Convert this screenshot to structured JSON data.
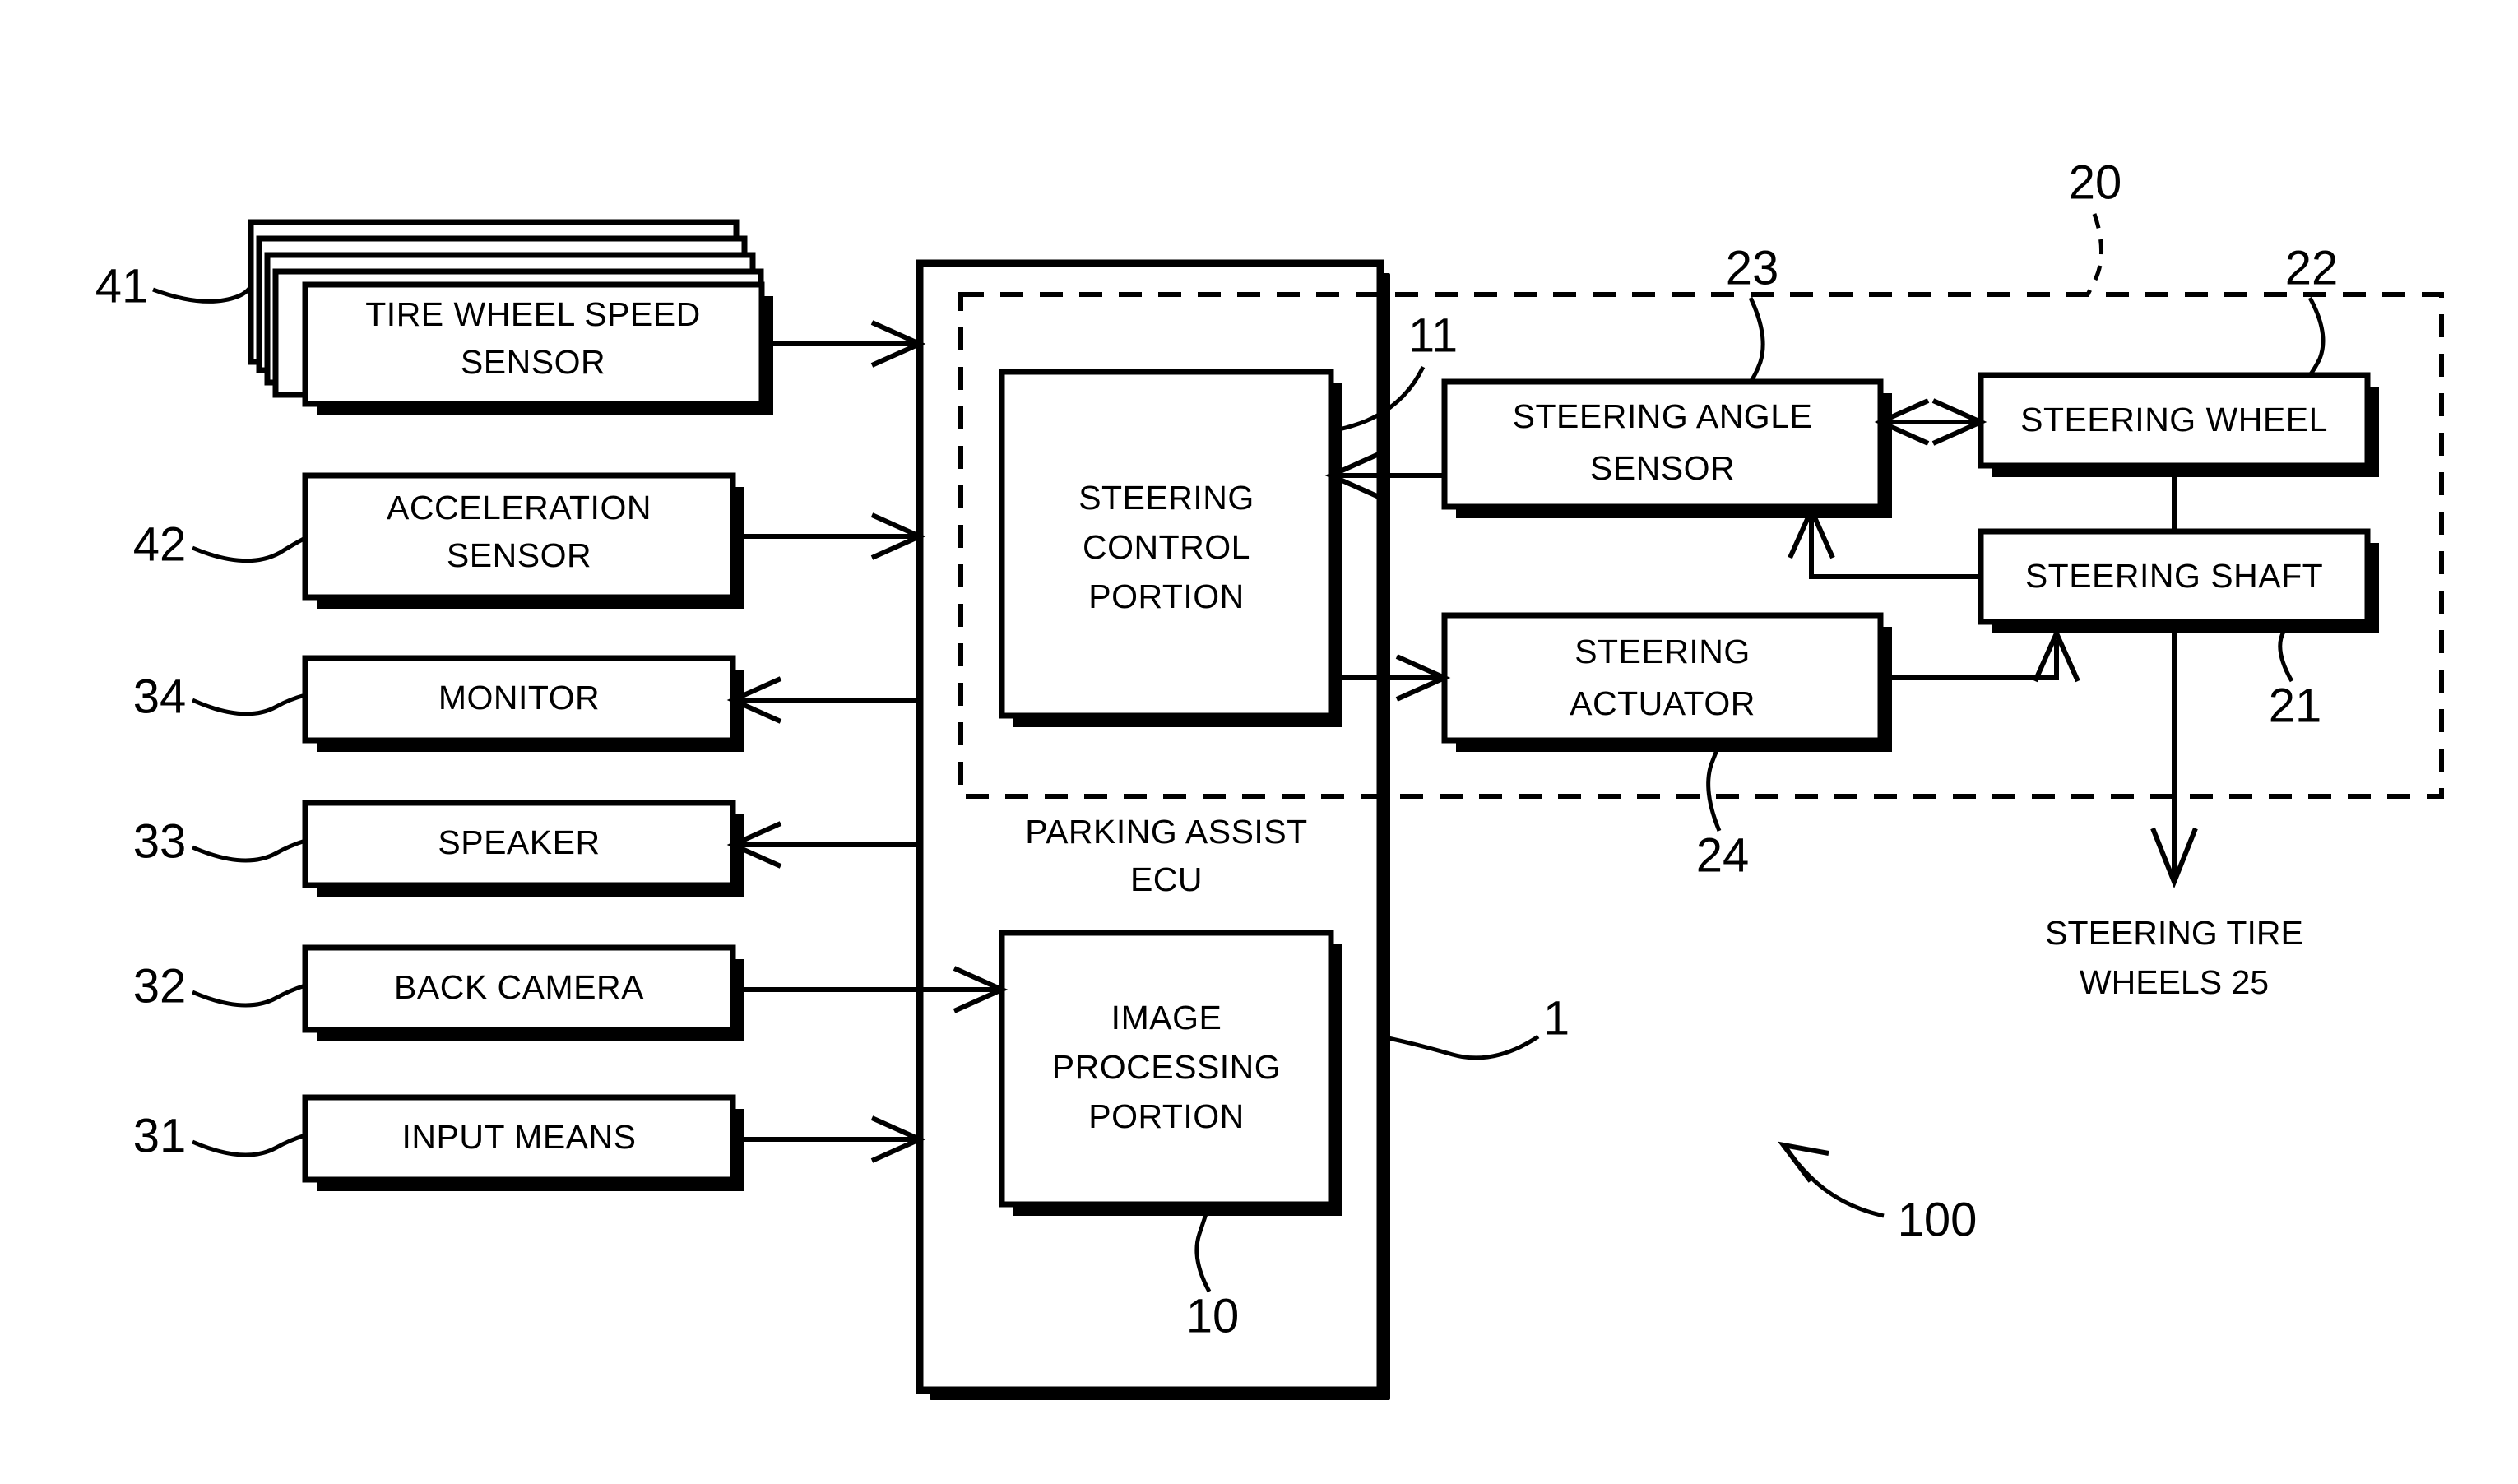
{
  "figure": {
    "type": "patent-block-diagram",
    "title_visible": false,
    "overall_ref": "100"
  },
  "blocks": {
    "tire_wheel_speed_sensor": {
      "label_line1": "TIRE WHEEL SPEED",
      "label_line2": "SENSOR",
      "ref": "41",
      "stacked_copies": 5
    },
    "acceleration_sensor": {
      "label_line1": "ACCELERATION",
      "label_line2": "SENSOR",
      "ref": "42"
    },
    "monitor": {
      "label": "MONITOR",
      "ref": "34"
    },
    "speaker": {
      "label": "SPEAKER",
      "ref": "33"
    },
    "back_camera": {
      "label": "BACK CAMERA",
      "ref": "32"
    },
    "input_means": {
      "label": "INPUT MEANS",
      "ref": "31"
    },
    "parking_assist_ecu": {
      "label_line1": "PARKING ASSIST",
      "label_line2": "ECU",
      "ref": "1"
    },
    "steering_control_portion": {
      "label_line1": "STEERING",
      "label_line2": "CONTROL",
      "label_line3": "PORTION",
      "ref": "11"
    },
    "image_processing_portion": {
      "label_line1": "IMAGE",
      "label_line2": "PROCESSING",
      "label_line3": "PORTION",
      "ref": "10"
    },
    "steering_angle_sensor": {
      "label_line1": "STEERING ANGLE",
      "label_line2": "SENSOR",
      "ref": "23"
    },
    "steering_actuator": {
      "label_line1": "STEERING",
      "label_line2": "ACTUATOR",
      "ref": "24"
    },
    "steering_wheel": {
      "label": "STEERING WHEEL",
      "ref": "22"
    },
    "steering_shaft": {
      "label": "STEERING SHAFT",
      "ref": "21"
    },
    "steering_system_group": {
      "ref": "20"
    },
    "steering_tire_wheels": {
      "label_line1": "STEERING TIRE",
      "label_line2": "WHEELS 25",
      "ref": "25"
    }
  },
  "colors": {
    "ink": "#000000",
    "paper": "#ffffff"
  }
}
